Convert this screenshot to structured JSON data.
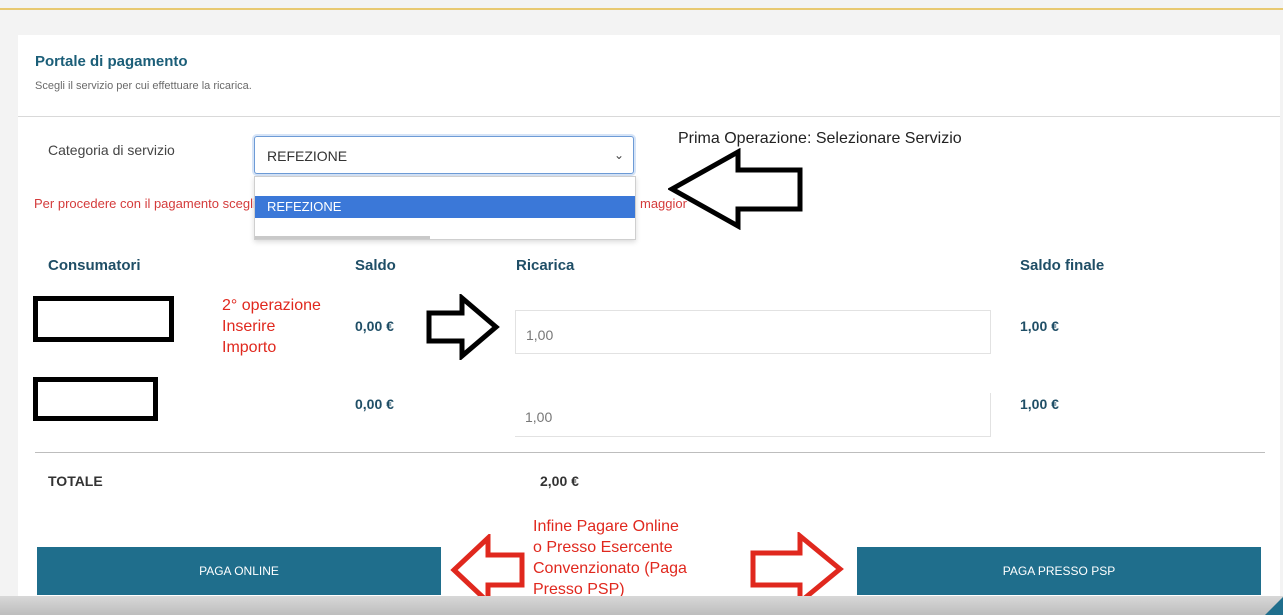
{
  "portal": {
    "title": "Portale di pagamento",
    "subtitle": "Scegli il servizio per cui effettuare la ricarica."
  },
  "service": {
    "label": "Categoria di servizio",
    "selected": "REFEZIONE",
    "options": [
      "REFEZIONE"
    ]
  },
  "warning": {
    "start": "Per procedere con il pagamento scegli",
    "end": "maggior"
  },
  "table": {
    "headers": {
      "consumers": "Consumatori",
      "balance": "Saldo",
      "topup": "Ricarica",
      "final": "Saldo finale"
    },
    "rows": [
      {
        "balance": "0,00 €",
        "topup": "1,00",
        "final": "1,00 €"
      },
      {
        "balance": "0,00 €",
        "topup": "1,00",
        "final": "1,00 €"
      }
    ],
    "total_label": "TOTALE",
    "total_value": "2,00 €"
  },
  "buttons": {
    "pay_online": "PAGA ONLINE",
    "pay_psp": "PAGA PRESSO PSP"
  },
  "annotations": {
    "step1": "Prima Operazione: Selezionare Servizio",
    "step2": [
      "2° operazione",
      "Inserire",
      "Importo"
    ],
    "step3": [
      "Infine Pagare Online",
      "o Presso Esercente",
      "Convenzionato (Paga",
      "Presso PSP)"
    ]
  },
  "colors": {
    "accent": "#1f6e8c",
    "header_text": "#1f4e66",
    "warning": "#d43b3b",
    "annotation_red": "#e0281e",
    "dropdown_highlight": "#3b78d8"
  },
  "icons": {
    "select_arrow": "chevron-down-icon",
    "step1_arrow": "arrow-left-icon",
    "step2_arrow": "arrow-right-icon",
    "step3_arrows": [
      "arrow-left-icon",
      "arrow-right-icon"
    ]
  }
}
